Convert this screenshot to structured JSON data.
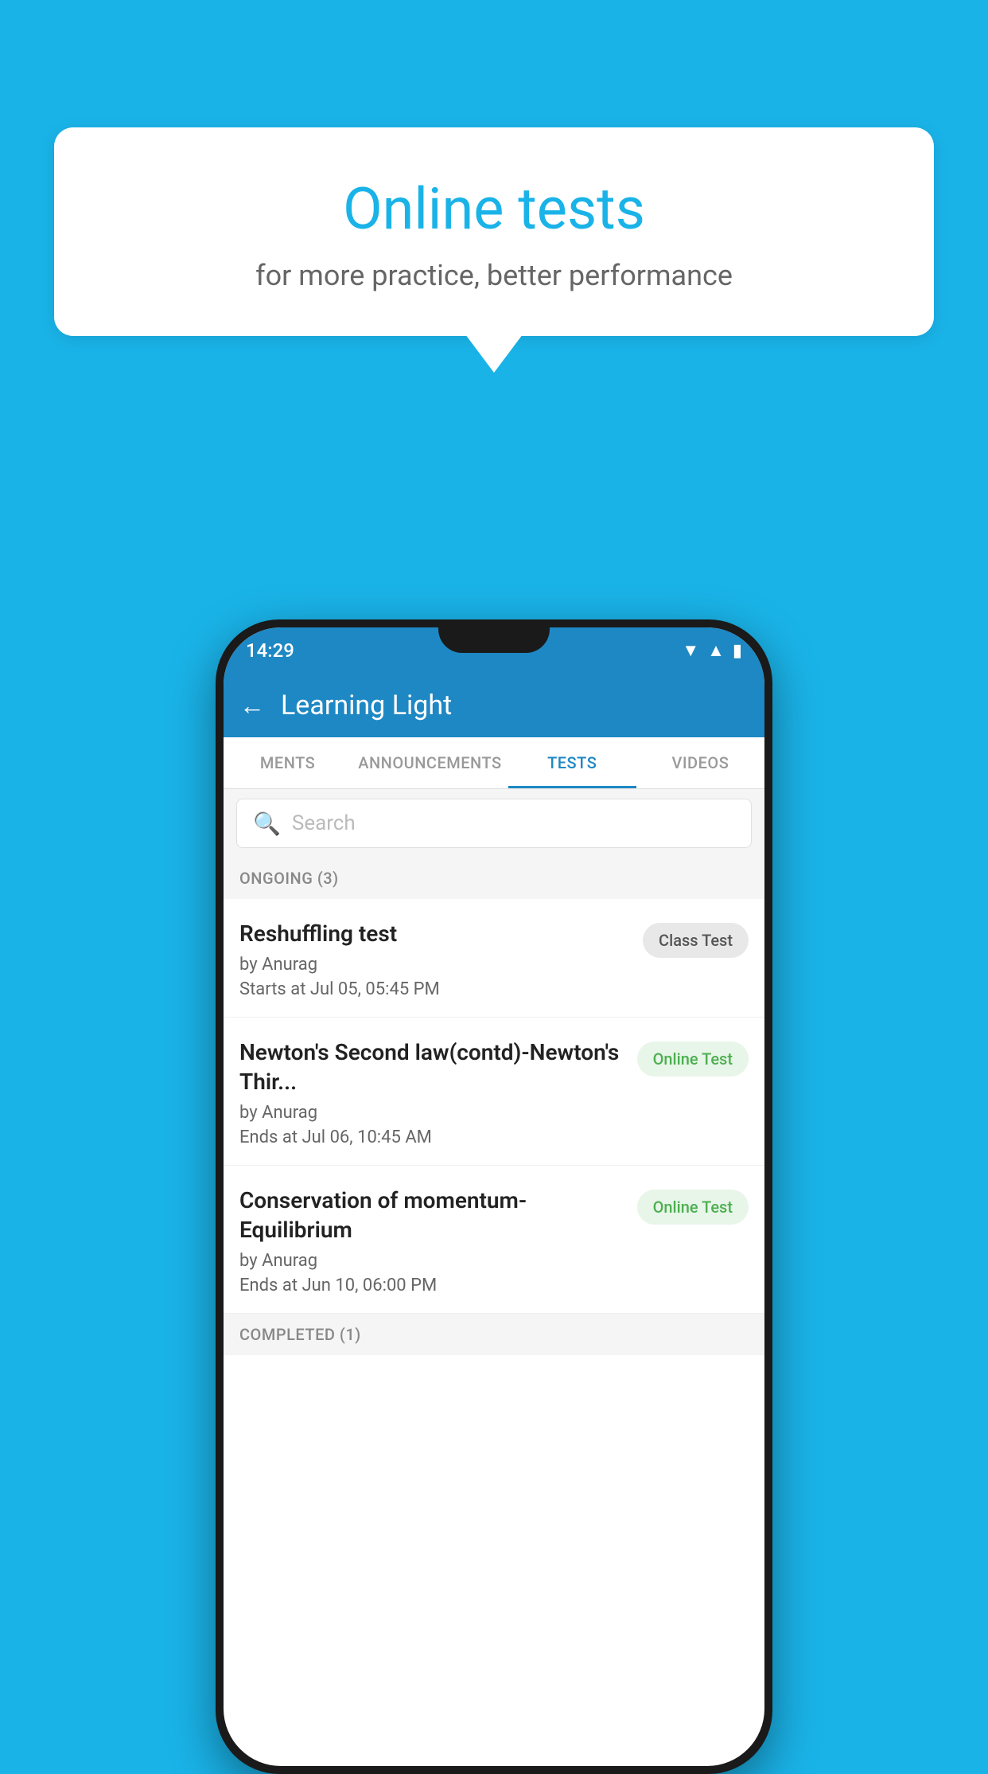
{
  "background_color": "#1ab3e8",
  "speech_bubble": {
    "title": "Online tests",
    "subtitle": "for more practice, better performance"
  },
  "phone": {
    "status_bar": {
      "time": "14:29",
      "icons": [
        "wifi",
        "signal",
        "battery"
      ]
    },
    "app_bar": {
      "back_label": "←",
      "title": "Learning Light"
    },
    "tabs": [
      {
        "label": "MENTS",
        "active": false
      },
      {
        "label": "ANNOUNCEMENTS",
        "active": false
      },
      {
        "label": "TESTS",
        "active": true
      },
      {
        "label": "VIDEOS",
        "active": false
      }
    ],
    "search": {
      "placeholder": "Search"
    },
    "section_ongoing": {
      "title": "ONGOING (3)"
    },
    "tests": [
      {
        "name": "Reshuffling test",
        "author": "by Anurag",
        "date": "Starts at  Jul 05, 05:45 PM",
        "badge": "Class Test",
        "badge_type": "class"
      },
      {
        "name": "Newton's Second law(contd)-Newton's Thir...",
        "author": "by Anurag",
        "date": "Ends at  Jul 06, 10:45 AM",
        "badge": "Online Test",
        "badge_type": "online"
      },
      {
        "name": "Conservation of momentum-Equilibrium",
        "author": "by Anurag",
        "date": "Ends at  Jun 10, 06:00 PM",
        "badge": "Online Test",
        "badge_type": "online"
      }
    ],
    "section_completed": {
      "title": "COMPLETED (1)"
    }
  }
}
